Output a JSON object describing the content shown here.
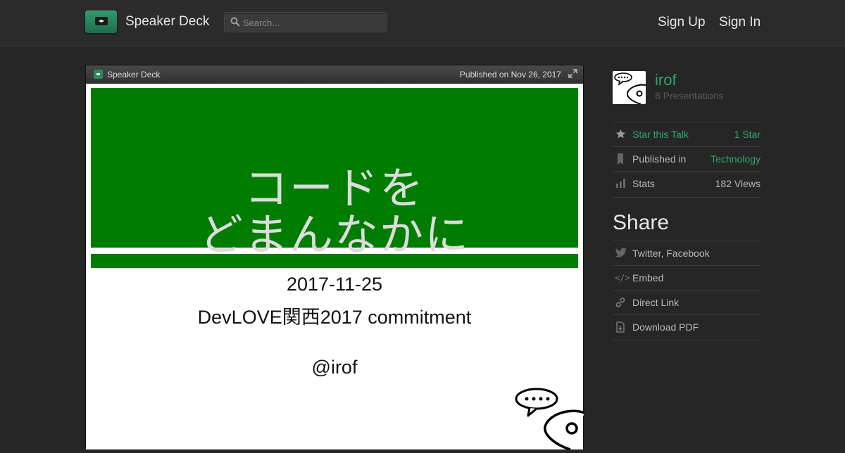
{
  "header": {
    "brand": "Speaker Deck",
    "search_placeholder": "Search...",
    "sign_up": "Sign Up",
    "sign_in": "Sign In"
  },
  "player": {
    "brand": "Speaker Deck",
    "published": "Published on Nov 26, 2017",
    "slide": {
      "title_line1": "コードを",
      "title_line2": "どまんなかに",
      "date": "2017-11-25",
      "event": "DevLOVE関西2017 commitment",
      "author": "@irof"
    }
  },
  "sidebar": {
    "user_name": "irof",
    "presentations": "8 Presentations",
    "star_label": "Star this Talk",
    "star_count": "1 Star",
    "published_in_label": "Published in",
    "category": "Technology",
    "stats_label": "Stats",
    "views": "182 Views",
    "share_heading": "Share",
    "share_items": [
      "Twitter, Facebook",
      "Embed",
      "Direct Link",
      "Download PDF"
    ]
  },
  "colors": {
    "accent": "#2fa86c",
    "slide_green": "#007d00",
    "background": "#262626"
  },
  "icons": [
    "search-icon",
    "star-icon",
    "bookmark-icon",
    "stats-icon",
    "twitter-icon",
    "embed-icon",
    "link-icon",
    "download-icon",
    "expand-icon"
  ]
}
